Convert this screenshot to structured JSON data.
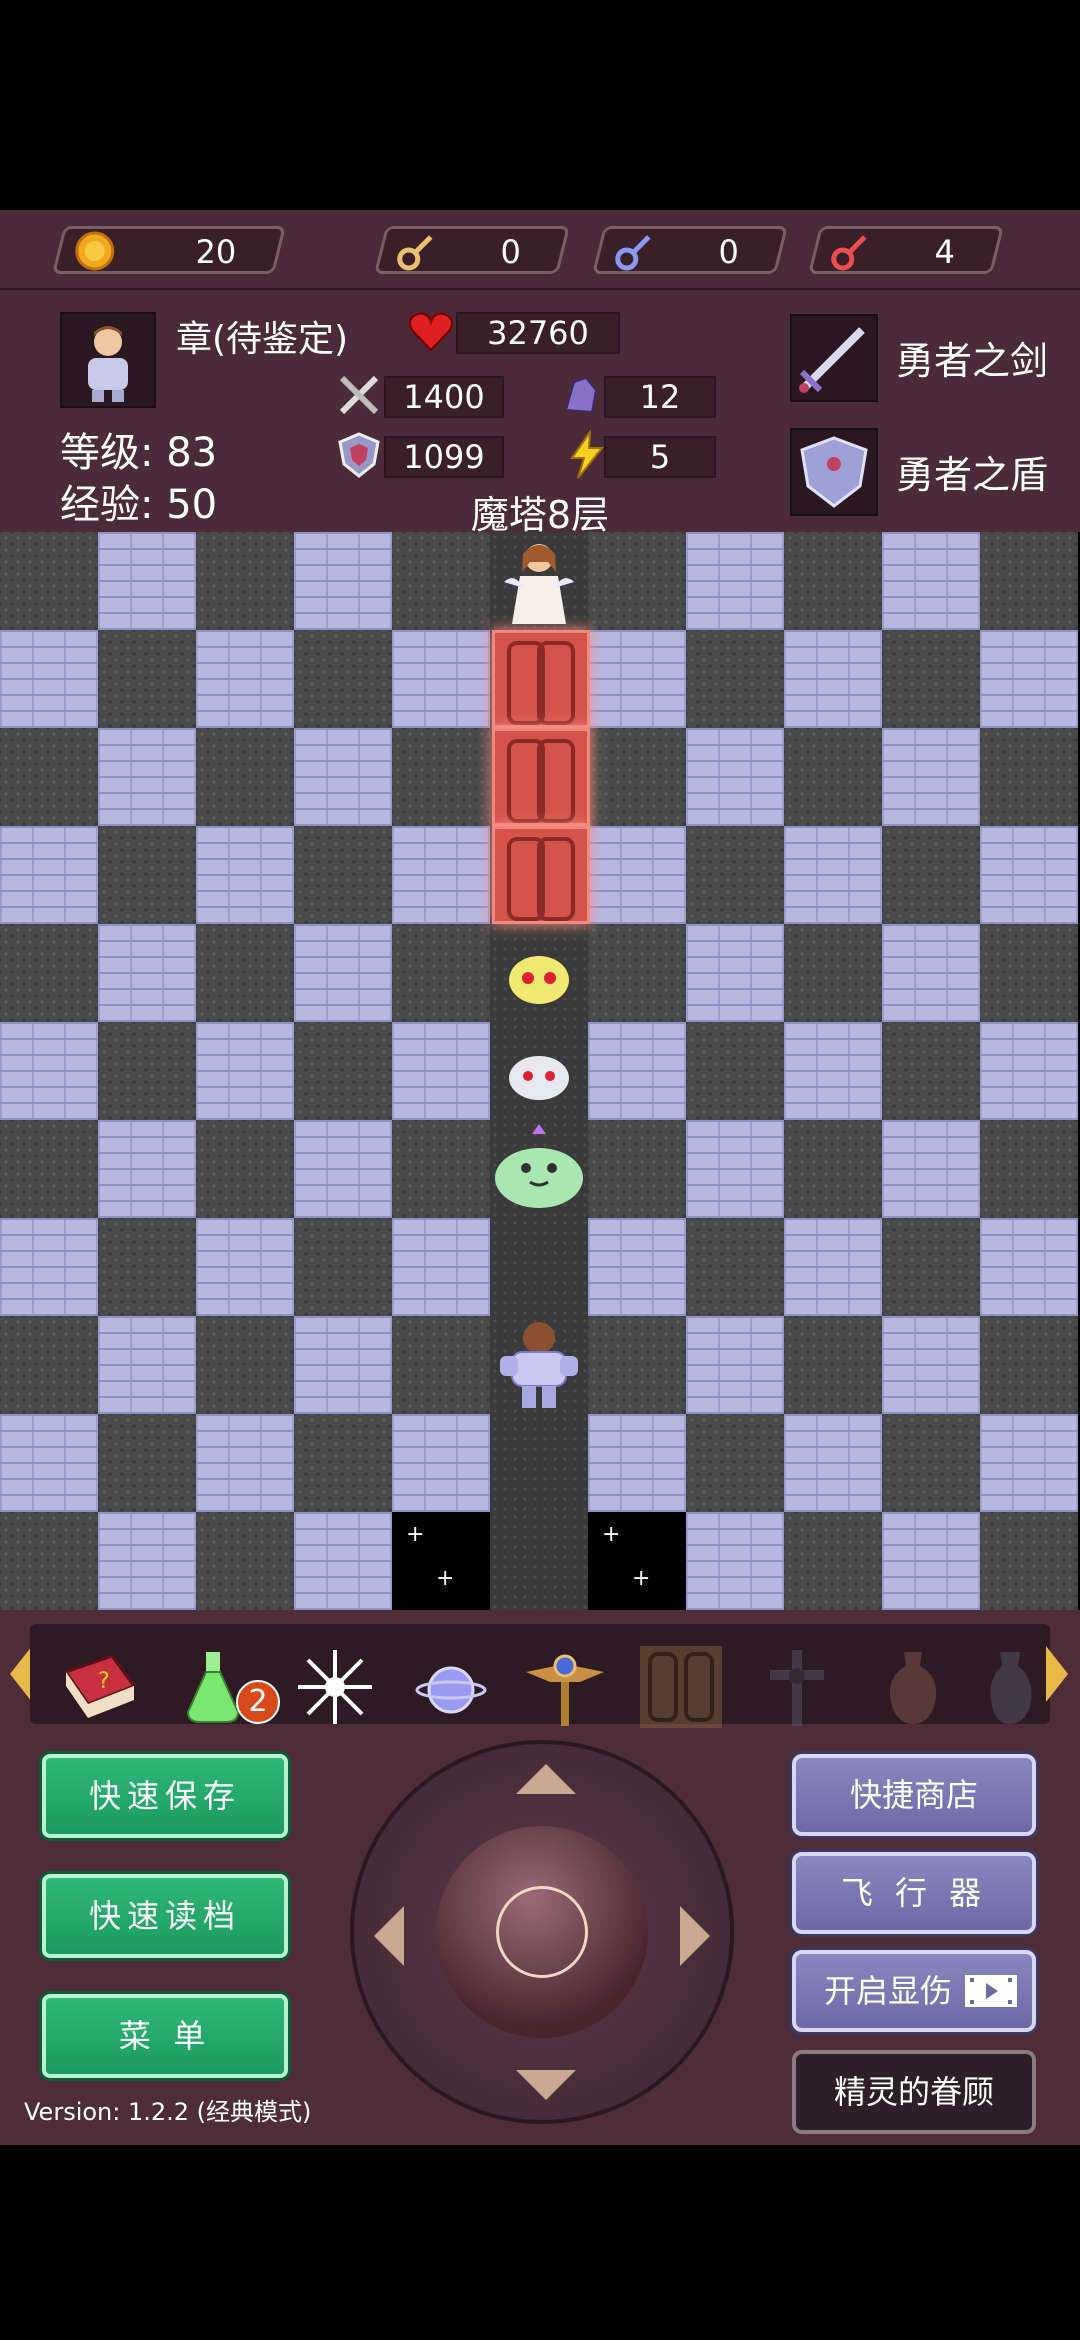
{
  "resources": {
    "gold": "20",
    "yellow_key": "0",
    "blue_key": "0",
    "red_key": "4"
  },
  "hero": {
    "name": "章(待鉴定)",
    "level_label": "等级:",
    "level": "83",
    "exp_label": "经验:",
    "exp": "50",
    "hp": "32760",
    "atk": "1400",
    "def": "1099",
    "magic_def": "12",
    "agility": "5"
  },
  "equipment": {
    "weapon": "勇者之剑",
    "armor": "勇者之盾"
  },
  "floor": "魔塔8层",
  "map": {
    "monsters": [
      "yellow-slime",
      "white-slime",
      "green-slime-king"
    ],
    "npc": "fairy",
    "gates": 3
  },
  "items": {
    "potion_count": "2"
  },
  "buttons": {
    "quick_save": "快速保存",
    "quick_load": "快速读档",
    "menu": "菜 单",
    "shop": "快捷商店",
    "fly": "飞 行 器",
    "show_damage": "开启显伤",
    "fairy_favor": "精灵的眷顾"
  },
  "version": "Version: 1.2.2 (经典模式)",
  "colors": {
    "panel": "#4b2b37",
    "green_button": "#1fa56a",
    "purple_button": "#7a77b4",
    "gate_red": "#d4544c"
  }
}
